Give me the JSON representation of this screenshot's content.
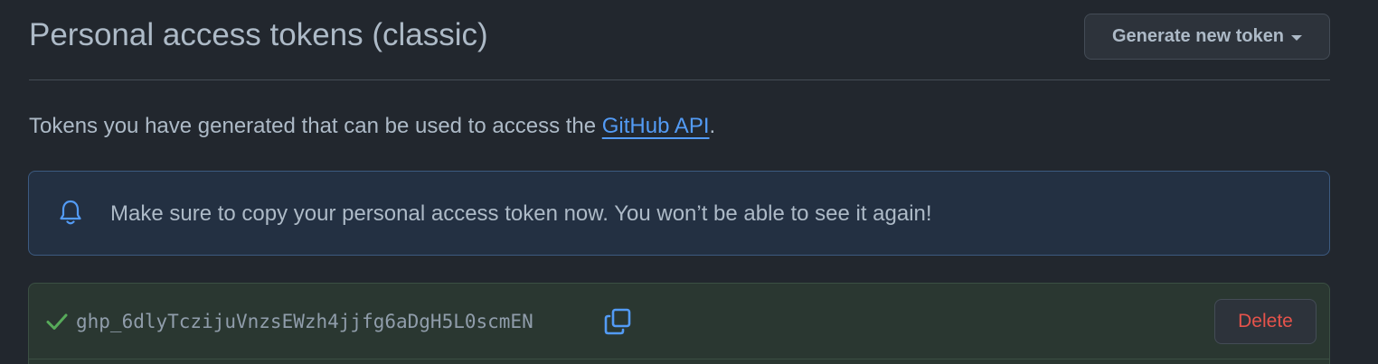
{
  "header": {
    "title": "Personal access tokens (classic)",
    "generate_button_label": "Generate new token",
    "generate_button_icon": "caret-down-icon"
  },
  "description": {
    "prefix": "Tokens you have generated that can be used to access the ",
    "link_text": "GitHub API",
    "suffix": "."
  },
  "flash": {
    "icon": "bell-icon",
    "message": "Make sure to copy your personal access token now. You won’t be able to see it again!"
  },
  "token": {
    "status_icon": "check-icon",
    "value": "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",
    "copy_icon": "copy-icon",
    "delete_label": "Delete"
  },
  "colors": {
    "background": "#22272e",
    "link": "#539bf5",
    "flash_background": "#233042",
    "flash_border": "#3c5a80",
    "success_background": "#2a3731",
    "success_icon": "#57ab5a",
    "danger": "#e5534b"
  }
}
